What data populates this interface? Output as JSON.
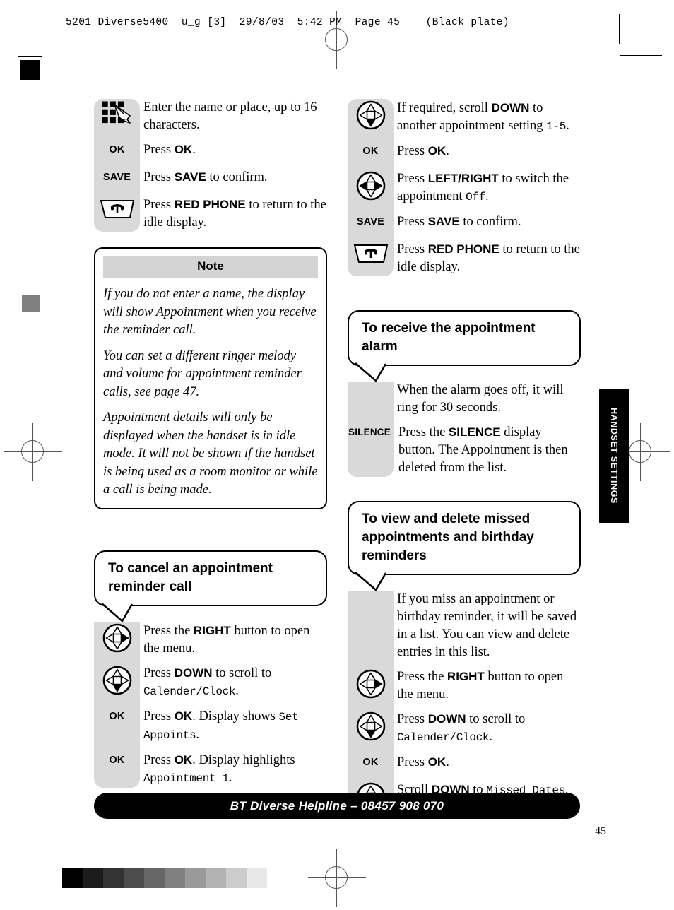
{
  "print_header": "5201 Diverse5400  u_g [3]  29/8/03  5:42 PM  Page 45    (Black plate)",
  "page_number": "45",
  "side_tab": {
    "label": "HANDSET SETTINGS"
  },
  "footer": {
    "text": "BT Diverse Helpline – 08457 908 070"
  },
  "gray_strip": {
    "swatches": [
      "#000000",
      "#1c1c1c",
      "#333333",
      "#4d4d4d",
      "#666666",
      "#808080",
      "#999999",
      "#b3b3b3",
      "#cccccc",
      "#e8e8e8"
    ]
  },
  "left_column": {
    "steps_top": [
      {
        "icon": "keypad-icon",
        "icon_label": "",
        "text_html": "Enter the name or place, up to 16 characters."
      },
      {
        "icon": "text-label",
        "icon_label": "OK",
        "text_html": "Press <b>OK</b>."
      },
      {
        "icon": "text-label",
        "icon_label": "SAVE",
        "text_html": "Press <b>SAVE</b> to confirm."
      },
      {
        "icon": "red-phone-icon",
        "icon_label": "",
        "text_html": "Press <b>RED PHONE</b> to return to the idle display."
      }
    ],
    "note": {
      "title": "Note",
      "paragraphs": [
        "If you do not enter a name, the display will show Appointment when you receive the reminder call.",
        "You can set a different ringer melody and volume for appointment reminder calls, see page 47.",
        "Appointment details will only be displayed when the handset is in idle mode. It will not be shown if the handset is being used as a room monitor or while a call is being made."
      ]
    },
    "section": {
      "heading": "To cancel an appointment reminder call",
      "steps": [
        {
          "icon": "dpad-right-icon",
          "icon_label": "",
          "text_html": "Press the <b>RIGHT</b> button to open the menu."
        },
        {
          "icon": "dpad-down-icon",
          "icon_label": "",
          "text_html": "Press <b>DOWN</b> to scroll to <span class=\"lcd\">Calender/Clock</span>."
        },
        {
          "icon": "text-label",
          "icon_label": "OK",
          "text_html": "Press <b>OK</b>. Display shows <span class=\"lcd\">Set Appoints</span>."
        },
        {
          "icon": "text-label",
          "icon_label": "OK",
          "text_html": "Press <b>OK</b>. Display highlights <span class=\"lcd\">Appointment 1</span>."
        }
      ]
    }
  },
  "right_column": {
    "steps_top": [
      {
        "icon": "dpad-down-icon",
        "icon_label": "",
        "text_html": "If required, scroll <b>DOWN</b> to another appointment setting <span class=\"lcd\">1-5</span>."
      },
      {
        "icon": "text-label",
        "icon_label": "OK",
        "text_html": "Press <b>OK</b>."
      },
      {
        "icon": "dpad-leftright-icon",
        "icon_label": "",
        "text_html": "Press <b>LEFT/RIGHT</b> to switch the appointment <span class=\"lcd\">Off</span>."
      },
      {
        "icon": "text-label",
        "icon_label": "SAVE",
        "text_html": "Press <b>SAVE</b> to confirm."
      },
      {
        "icon": "red-phone-icon",
        "icon_label": "",
        "text_html": "Press <b>RED PHONE</b> to return to the idle display."
      }
    ],
    "section_alarm": {
      "heading": "To receive the appointment alarm",
      "steps": [
        {
          "icon": "none",
          "icon_label": "",
          "text_html": "When the alarm goes off, it will ring for 30 seconds."
        },
        {
          "icon": "text-label-wide",
          "icon_label": "SILENCE",
          "text_html": "Press the <b>SILENCE</b> display button. The Appointment is then deleted from the list."
        }
      ]
    },
    "section_missed": {
      "heading": "To view and delete missed appointments and birthday reminders",
      "steps": [
        {
          "icon": "none",
          "icon_label": "",
          "text_html": "If you miss an appointment or birthday reminder, it will be saved in a list. You can view and delete entries in this list."
        },
        {
          "icon": "dpad-right-icon",
          "icon_label": "",
          "text_html": "Press the <b>RIGHT</b> button to open the menu."
        },
        {
          "icon": "dpad-down-icon",
          "icon_label": "",
          "text_html": "Press <b>DOWN</b> to scroll to <span class=\"lcd\">Calender/Clock</span>."
        },
        {
          "icon": "text-label",
          "icon_label": "OK",
          "text_html": "Press <b>OK</b>."
        },
        {
          "icon": "dpad-down-icon",
          "icon_label": "",
          "text_html": "Scroll <b>DOWN</b> to <span class=\"lcd\">Missed Dates</span>."
        }
      ]
    }
  }
}
